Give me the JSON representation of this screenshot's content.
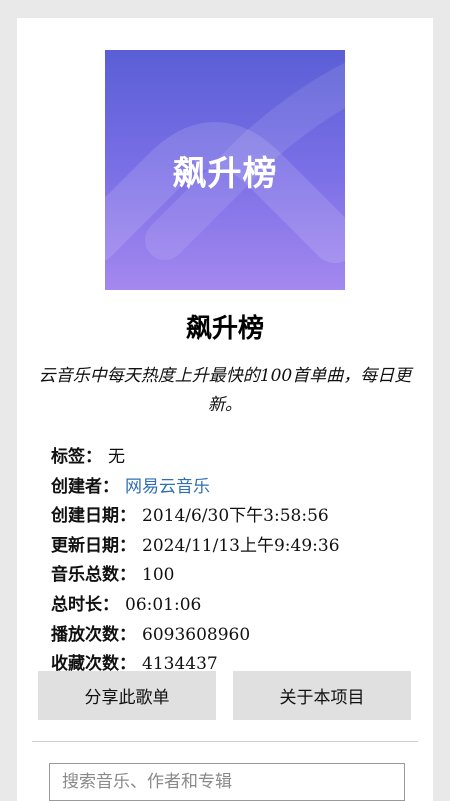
{
  "cover": {
    "text": "飙升榜"
  },
  "playlist": {
    "title": "飙升榜",
    "description": "云音乐中每天热度上升最快的100首单曲，每日更新。"
  },
  "info": {
    "tags_label": "标签：",
    "tags": "无",
    "creator_label": "创建者：",
    "creator": "网易云音乐",
    "created_label": "创建日期：",
    "created": "2014/6/30下午3:58:56",
    "updated_label": "更新日期：",
    "updated": "2024/11/13上午9:49:36",
    "track_count_label": "音乐总数：",
    "track_count": "100",
    "duration_label": "总时长：",
    "duration": "06:01:06",
    "play_count_label": "播放次数：",
    "play_count": "6093608960",
    "subscribed_label": "收藏次数：",
    "subscribed": "4134437"
  },
  "actions": {
    "share_label": "分享此歌单",
    "about_label": "关于本项目"
  },
  "search": {
    "placeholder": "搜索音乐、作者和专辑"
  },
  "colors": {
    "link": "#2f6fb3",
    "button_bg": "#e0e0e0",
    "cover_top": "#5a5fd6",
    "cover_bottom": "#a488ef"
  }
}
